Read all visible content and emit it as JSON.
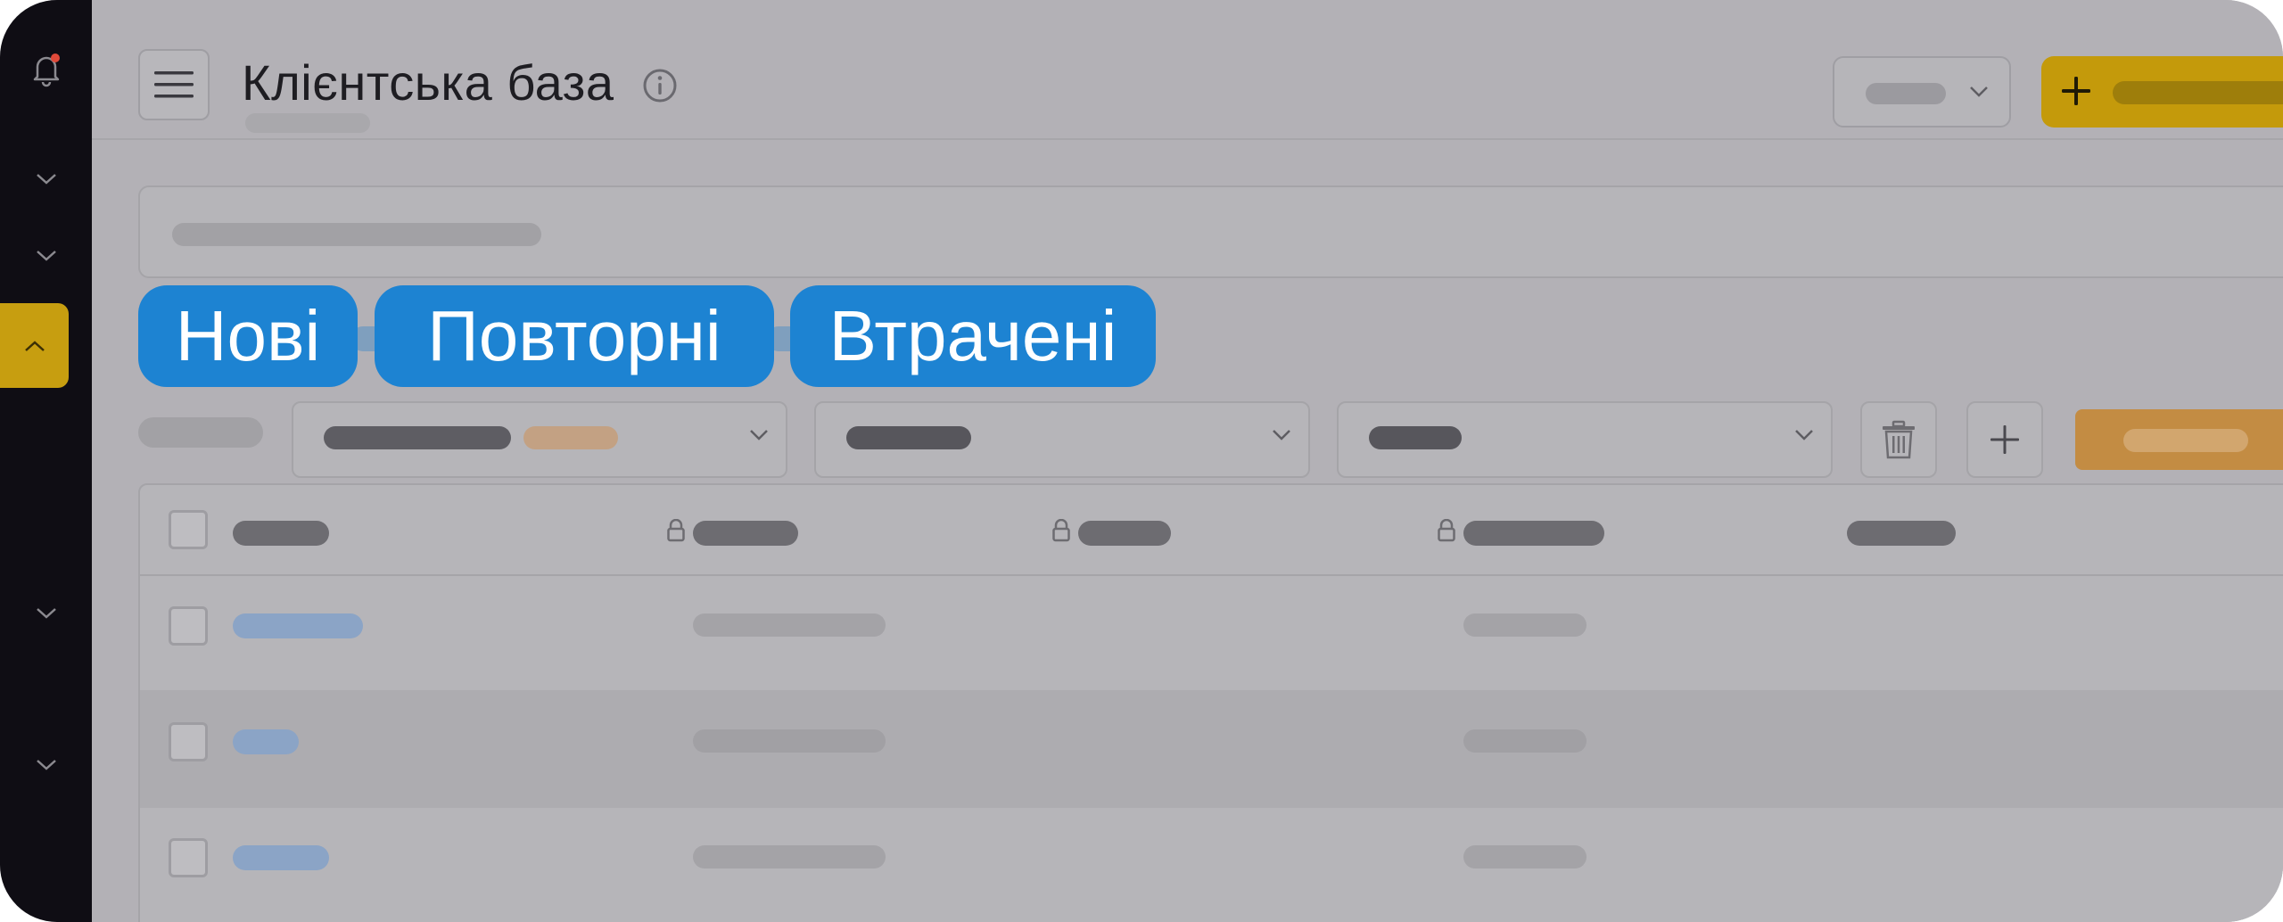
{
  "header": {
    "title": "Клієнтська база"
  },
  "tabs": [
    {
      "label": "Нові"
    },
    {
      "label": "Повторні"
    },
    {
      "label": "Втрачені"
    }
  ],
  "colors": {
    "sidebar_bg": "#0f0d14",
    "accent": "#c79e10",
    "tab_highlight": "#1d83d2",
    "apply_button": "#c38c43",
    "notification_dot": "#e04a3a"
  },
  "icons": {
    "sidebar": [
      "bell-icon",
      "chevron-down-icon",
      "chevron-down-icon",
      "chevron-up-icon",
      "chevron-down-icon",
      "chevron-down-icon"
    ],
    "header": [
      "hamburger-menu-icon",
      "info-icon",
      "chevron-down-icon",
      "plus-icon"
    ],
    "filters": [
      "chevron-down-icon",
      "trash-icon",
      "plus-icon",
      "lock-icon"
    ]
  }
}
